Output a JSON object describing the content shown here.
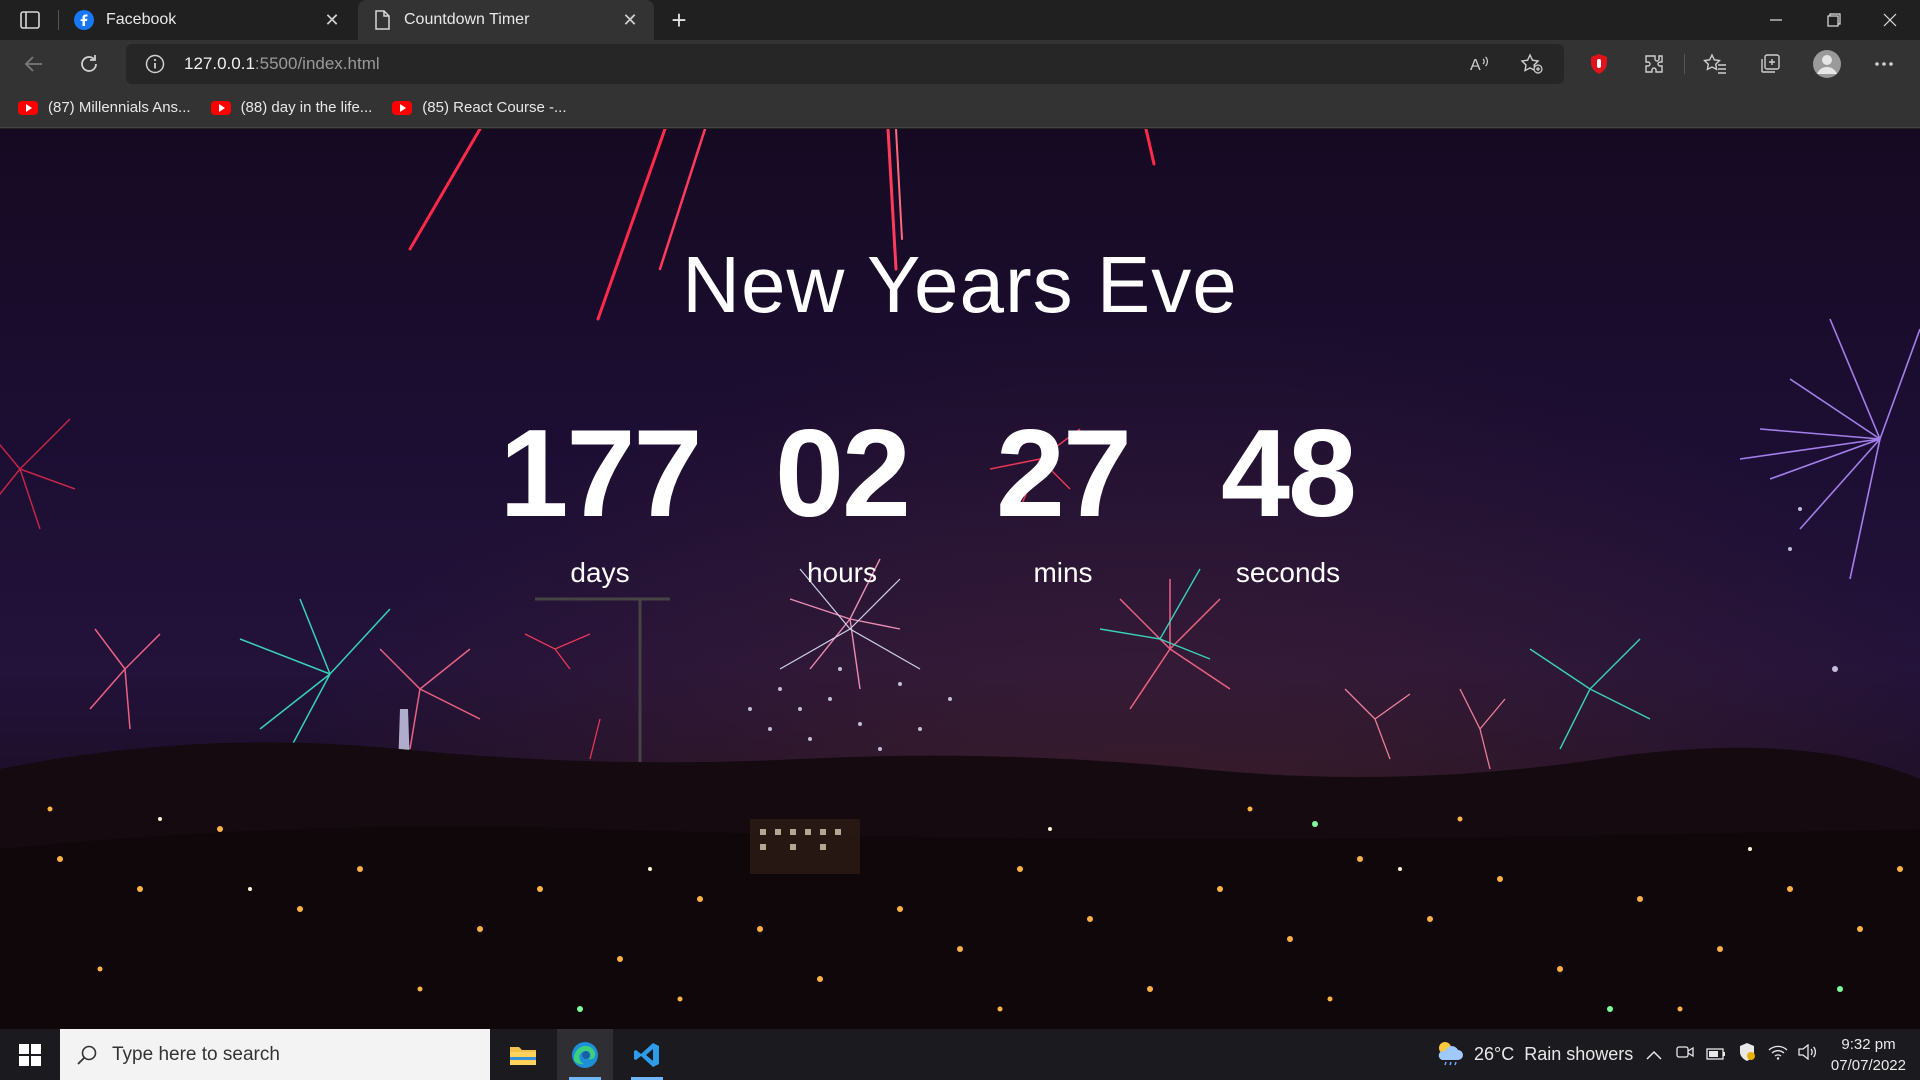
{
  "browser": {
    "tabs": [
      {
        "label": "Facebook",
        "favicon": "facebook-icon",
        "active": false
      },
      {
        "label": "Countdown Timer",
        "favicon": "page-icon",
        "active": true
      }
    ],
    "url_host": "127.0.0.1",
    "url_rest": ":5500/index.html",
    "bookmarks": [
      {
        "label": "(87) Millennials Ans..."
      },
      {
        "label": "(88) day in the life..."
      },
      {
        "label": "(85) React Course -..."
      }
    ]
  },
  "page": {
    "title": "New Years Eve",
    "countdown": [
      {
        "value": "177",
        "label": "days"
      },
      {
        "value": "02",
        "label": "hours"
      },
      {
        "value": "27",
        "label": "mins"
      },
      {
        "value": "48",
        "label": "seconds"
      }
    ]
  },
  "taskbar": {
    "search_placeholder": "Type here to search",
    "weather_temp": "26°C",
    "weather_text": "Rain showers",
    "time": "9:32 pm",
    "date": "07/07/2022"
  },
  "colors": {
    "chrome_dark": "#202020",
    "chrome_toolbar": "#333333",
    "accent_blue": "#6fb6ff",
    "youtube_red": "#ff0000"
  }
}
